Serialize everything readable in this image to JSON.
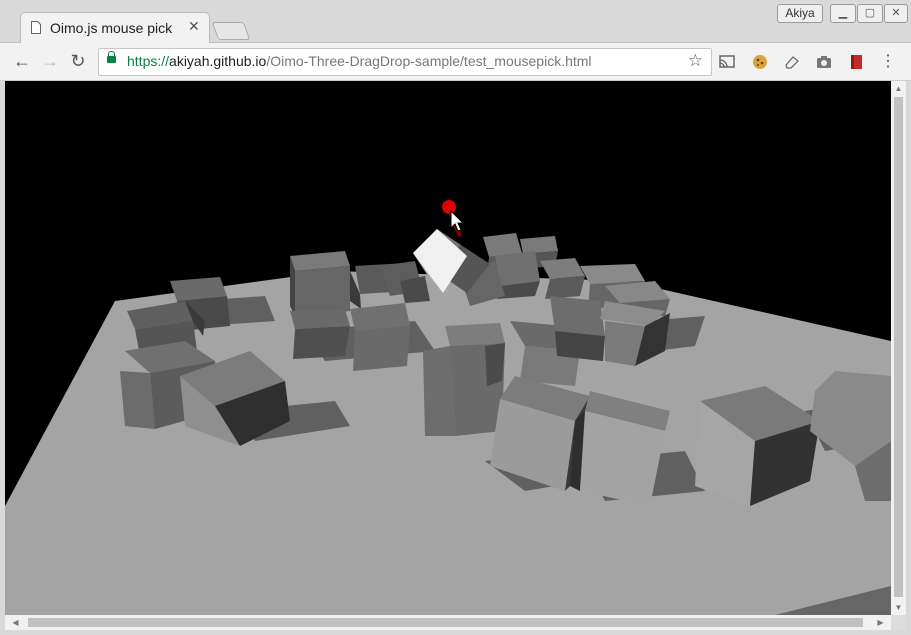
{
  "tab": {
    "title": "Oimo.js mouse pick",
    "close": "✕"
  },
  "window": {
    "profile": "Akiya",
    "minimize": "▁",
    "maximize": "▢",
    "close": "✕"
  },
  "nav": {
    "back": "←",
    "forward": "→",
    "reload": "↻"
  },
  "address": {
    "scheme": "https://",
    "host": "akiyah.github.io",
    "path": "/Oimo-Three-DragDrop-sample/test_mousepick.html",
    "star": "☆"
  },
  "extensions": [
    "cast-icon",
    "cookie-icon",
    "eraser-icon",
    "camera-icon",
    "book-icon",
    "menu-icon"
  ],
  "colors": {
    "floor": "#a3a3a3",
    "sky": "#000000",
    "picked_cube": "#f0f0f0",
    "marker": "#e00000",
    "secure": "#0b8043"
  }
}
